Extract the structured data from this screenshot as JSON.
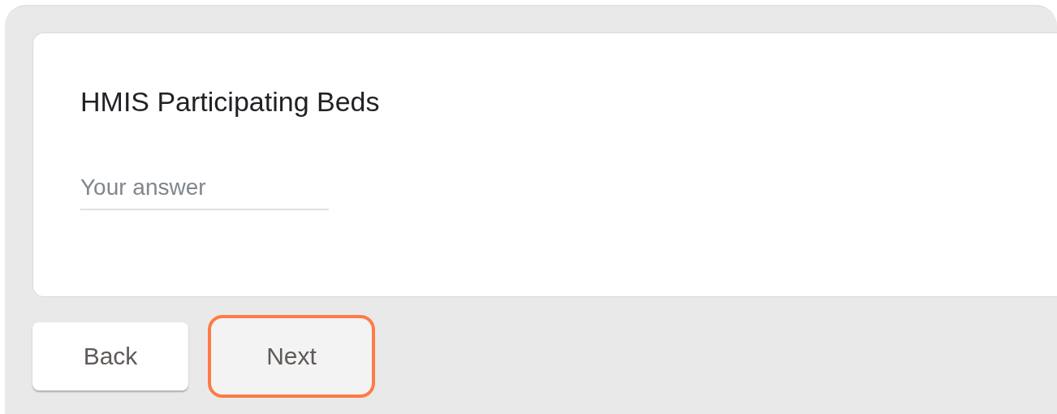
{
  "question": {
    "title": "HMIS Participating Beds",
    "answer": {
      "placeholder": "Your answer"
    }
  },
  "buttons": [
    {
      "label": "Back",
      "highlighted": false
    },
    {
      "label": "Next",
      "highlighted": true
    }
  ]
}
